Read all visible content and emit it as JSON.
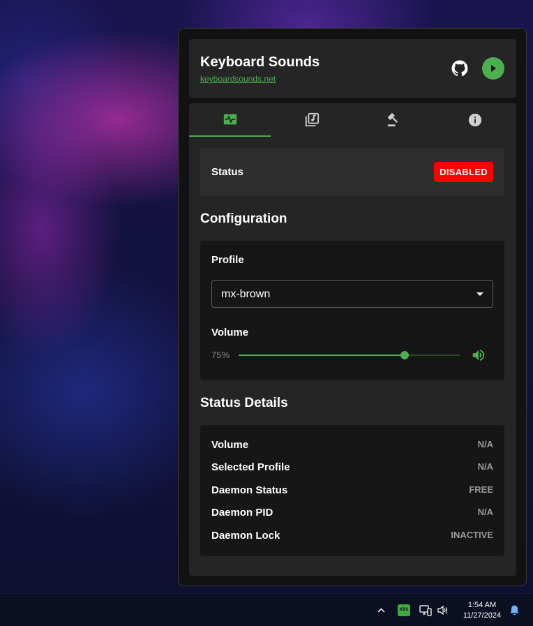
{
  "app": {
    "title": "Keyboard Sounds",
    "website": "keyboardsounds.net",
    "accent_color": "#4caf50",
    "header_icons": [
      "github-icon",
      "play-icon"
    ]
  },
  "tabs": [
    {
      "icon": "activity-icon",
      "active": true
    },
    {
      "icon": "music-library-icon",
      "active": false
    },
    {
      "icon": "gavel-icon",
      "active": false
    },
    {
      "icon": "info-icon",
      "active": false
    }
  ],
  "status": {
    "label": "Status",
    "badge": "DISABLED",
    "badge_color": "#ff0000"
  },
  "configuration": {
    "heading": "Configuration",
    "profile_label": "Profile",
    "profile_value": "mx-brown",
    "volume_label": "Volume",
    "volume_value": "75%",
    "volume_level": 0.75
  },
  "details": {
    "heading": "Status Details",
    "rows": [
      {
        "label": "Volume",
        "value": "N/A"
      },
      {
        "label": "Selected Profile",
        "value": "N/A"
      },
      {
        "label": "Daemon Status",
        "value": "FREE"
      },
      {
        "label": "Daemon PID",
        "value": "N/A"
      },
      {
        "label": "Daemon Lock",
        "value": "INACTIVE"
      }
    ]
  },
  "taskbar": {
    "tray_app_label": "KBS",
    "time": "1:54 AM",
    "date": "11/27/2024",
    "icons": [
      "chevron-up-icon",
      "keyboard-sounds-tray-icon",
      "network-icon",
      "speaker-icon",
      "notification-bell-icon"
    ]
  }
}
